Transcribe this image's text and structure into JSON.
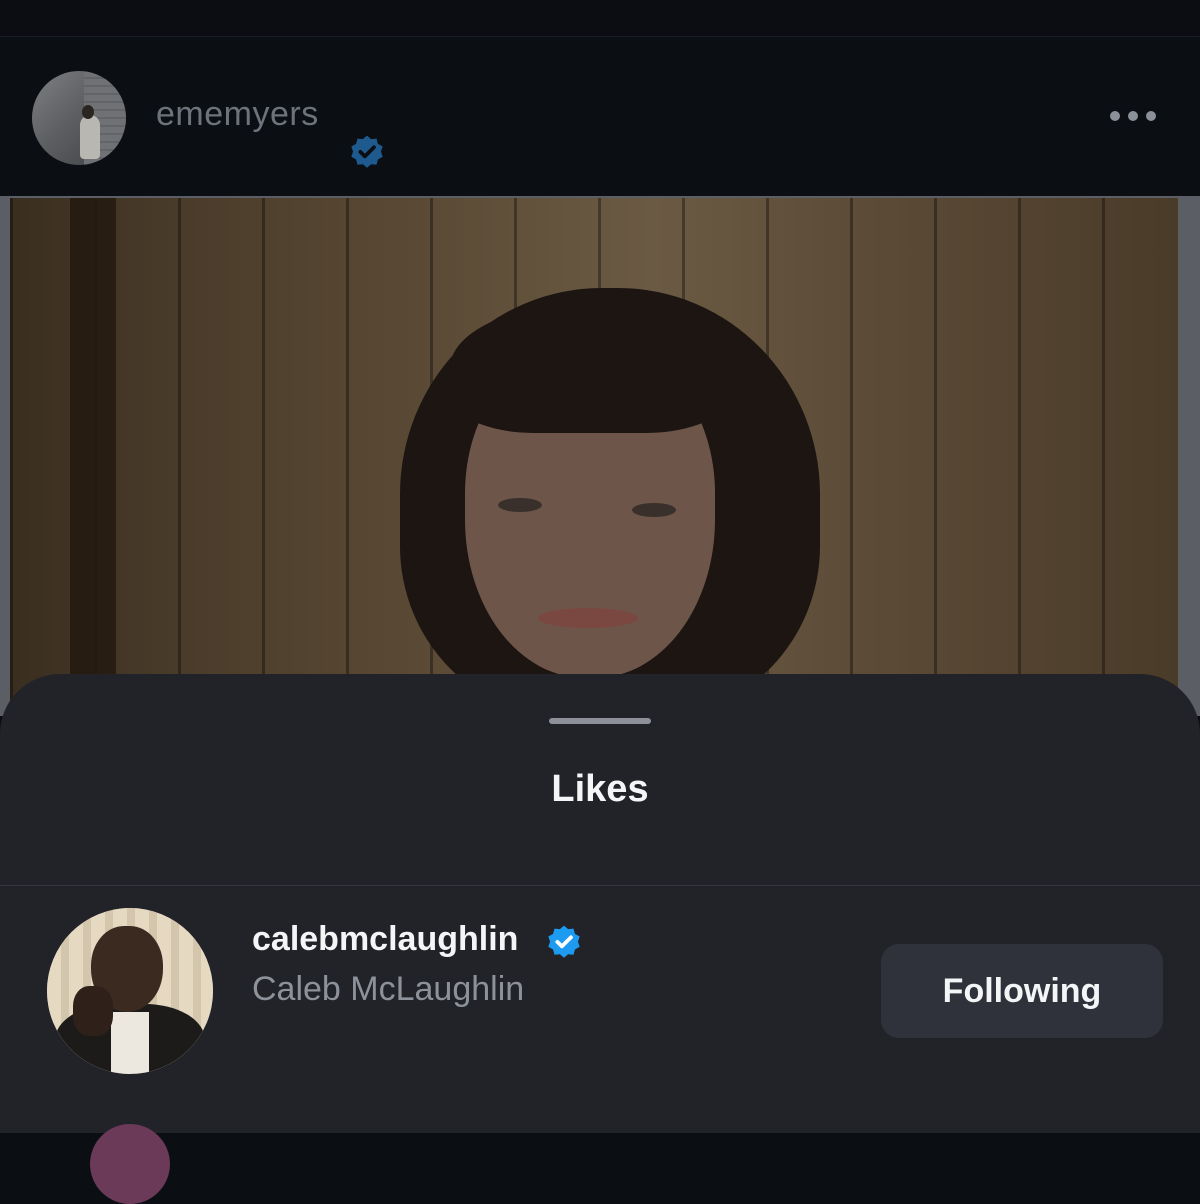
{
  "post": {
    "owner_username": "ememyers",
    "owner_verified": true
  },
  "sheet": {
    "title": "Likes"
  },
  "likes": [
    {
      "username": "calebmclaughlin",
      "full_name": "Caleb McLaughlin",
      "verified": true,
      "follow_label": "Following"
    }
  ],
  "colors": {
    "verified_badge": "#1d9bf0",
    "sheet_background": "#212329",
    "button_background": "#2f323a"
  }
}
